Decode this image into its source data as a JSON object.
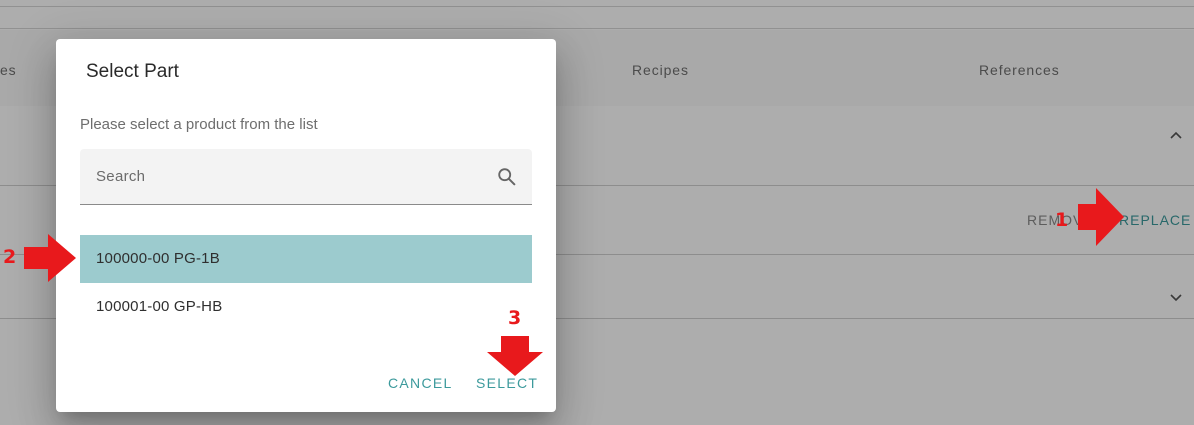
{
  "background": {
    "tabs": [
      {
        "label": "es"
      },
      {
        "label": "Recipes"
      },
      {
        "label": "References"
      }
    ],
    "actions": {
      "remove_label": "REMOVE",
      "replace_label": "REPLACE"
    }
  },
  "dialog": {
    "title": "Select Part",
    "subtitle": "Please select a product from the list",
    "search": {
      "placeholder": "Search",
      "value": ""
    },
    "items": [
      {
        "label": "100000-00 PG-1B",
        "selected": true
      },
      {
        "label": "100001-00 GP-HB",
        "selected": false
      }
    ],
    "cancel_label": "CANCEL",
    "select_label": "SELECT"
  },
  "annotations": [
    {
      "number": "1",
      "target": "replace-button"
    },
    {
      "number": "2",
      "target": "list-item-1"
    },
    {
      "number": "3",
      "target": "select-button"
    }
  ],
  "colors": {
    "accent": "#3c9a9c",
    "selected_row": "#9ccbce",
    "annotation": "#e8191c",
    "overlay": "rgba(0,0,0,0.32)"
  }
}
